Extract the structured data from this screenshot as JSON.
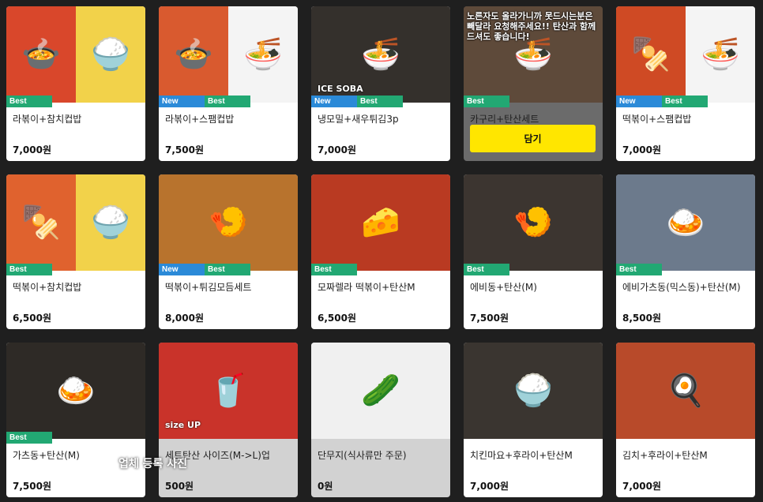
{
  "colors": {
    "background": "#1f1f1f",
    "badge_new": "#2b8ad8",
    "badge_best": "#22a873",
    "cta": "#ffe600"
  },
  "menu_items": [
    {
      "name": "라볶이+참치컵밥",
      "price": "7,000원",
      "badges": [
        "Best"
      ],
      "photo": [
        "🍲",
        "🍚"
      ],
      "bg": [
        "#d9472b",
        "#f2d24a"
      ],
      "state": "normal"
    },
    {
      "name": "라볶이+스팸컵밥",
      "price": "7,500원",
      "badges": [
        "New",
        "Best"
      ],
      "photo": [
        "🍲",
        "🍜"
      ],
      "bg": [
        "#d95a2f",
        "#f4f4f4"
      ],
      "state": "normal"
    },
    {
      "name": "냉모밀+새우튀김3p",
      "price": "7,000원",
      "badges": [
        "New",
        "Best"
      ],
      "photo": [
        "🍜"
      ],
      "bg": [
        "#34302c"
      ],
      "state": "normal",
      "photo_text": "ICE SOBA"
    },
    {
      "name": "카구리+탄산세트",
      "price": "",
      "badges": [
        "Best"
      ],
      "photo": [
        "🍜"
      ],
      "bg": [
        "#5e4a3a"
      ],
      "state": "dark",
      "notice": "노른자도 올라가니까 못드시는분은 빼달라 요청해주세요!! 탄산과 함께 드셔도 좋습니다!",
      "cta": "담기"
    },
    {
      "name": "떡볶이+스팸컵밥",
      "price": "7,000원",
      "badges": [
        "New",
        "Best"
      ],
      "photo": [
        "🍢",
        "🍜"
      ],
      "bg": [
        "#cf4a24",
        "#f4f4f4"
      ],
      "state": "normal"
    },
    {
      "name": "떡볶이+참치컵밥",
      "price": "6,500원",
      "badges": [
        "Best"
      ],
      "photo": [
        "🍢",
        "🍚"
      ],
      "bg": [
        "#e0622e",
        "#f2d24a"
      ],
      "state": "normal"
    },
    {
      "name": "떡볶이+튀김모듬세트",
      "price": "8,000원",
      "badges": [
        "New",
        "Best"
      ],
      "photo": [
        "🍤"
      ],
      "bg": [
        "#b8732d"
      ],
      "state": "normal"
    },
    {
      "name": "모짜렐라 떡볶이+탄산M",
      "price": "6,500원",
      "badges": [
        "Best"
      ],
      "photo": [
        "🧀"
      ],
      "bg": [
        "#b93a22"
      ],
      "state": "normal"
    },
    {
      "name": "에비동+탄산(M)",
      "price": "7,500원",
      "badges": [
        "Best"
      ],
      "photo": [
        "🍤"
      ],
      "bg": [
        "#3c3530"
      ],
      "state": "normal"
    },
    {
      "name": "에비가츠동(믹스동)+탄산(M)",
      "price": "8,500원",
      "badges": [
        "Best"
      ],
      "photo": [
        "🍛"
      ],
      "bg": [
        "#6c7a8c"
      ],
      "state": "normal"
    },
    {
      "name": "가츠동+탄산(M)",
      "price": "7,500원",
      "badges": [
        "Best"
      ],
      "photo": [
        "🍛"
      ],
      "bg": [
        "#2e2a26"
      ],
      "state": "normal"
    },
    {
      "name": "세트탄산 사이즈(M->L)업",
      "price": "500원",
      "badges": [],
      "photo": [
        "🥤"
      ],
      "bg": [
        "#c9332a"
      ],
      "state": "dim",
      "photo_text": "size UP"
    },
    {
      "name": "단무지(식사류만 주문)",
      "price": "0원",
      "badges": [],
      "photo": [
        "🥒"
      ],
      "bg": [
        "#f0f0f0"
      ],
      "state": "dim"
    },
    {
      "name": "치킨마요+후라이+탄산M",
      "price": "7,000원",
      "badges": [],
      "photo": [
        "🍚"
      ],
      "bg": [
        "#3a3530"
      ],
      "state": "normal"
    },
    {
      "name": "김치+후라이+탄산M",
      "price": "7,000원",
      "badges": [],
      "photo": [
        "🍳"
      ],
      "bg": [
        "#b84a2a"
      ],
      "state": "normal"
    }
  ],
  "overlay_caption": "업체 등록 사진"
}
